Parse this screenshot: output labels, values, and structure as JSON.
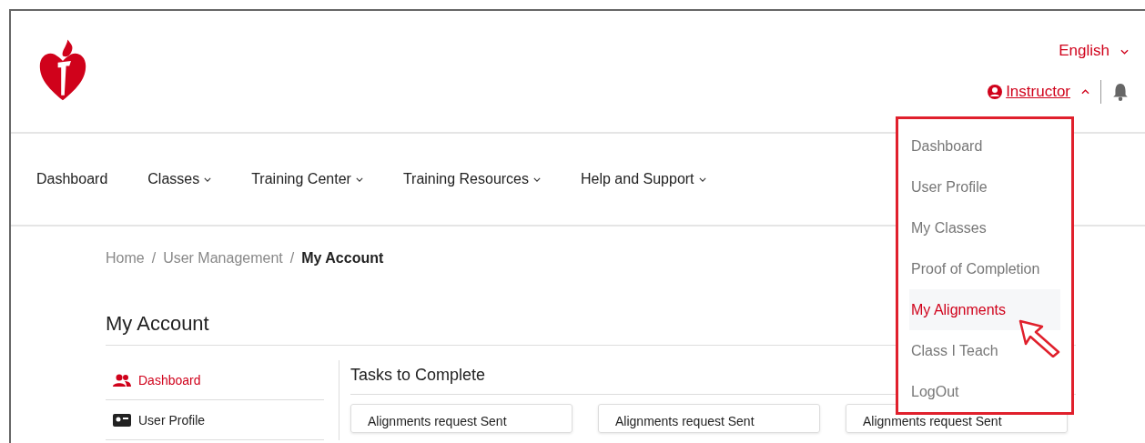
{
  "header": {
    "language": "English",
    "user": "Instructor"
  },
  "nav": [
    {
      "label": "Dashboard",
      "dropdown": false
    },
    {
      "label": "Classes",
      "dropdown": true
    },
    {
      "label": "Training Center",
      "dropdown": true
    },
    {
      "label": "Training Resources",
      "dropdown": true
    },
    {
      "label": "Help and Support",
      "dropdown": true
    }
  ],
  "user_menu": [
    {
      "label": "Dashboard",
      "selected": false
    },
    {
      "label": "User Profile",
      "selected": false
    },
    {
      "label": "My Classes",
      "selected": false
    },
    {
      "label": "Proof of Completion",
      "selected": false
    },
    {
      "label": "My Alignments",
      "selected": true
    },
    {
      "label": "Class I Teach",
      "selected": false
    },
    {
      "label": "LogOut",
      "selected": false
    }
  ],
  "breadcrumb_separator": "/",
  "breadcrumb": [
    {
      "label": "Home",
      "current": false
    },
    {
      "label": "User Management",
      "current": false
    },
    {
      "label": "My Account",
      "current": true
    }
  ],
  "page_title": "My Account",
  "sidebar": [
    {
      "label": "Dashboard",
      "kind": "users",
      "selected": true
    },
    {
      "label": "User Profile",
      "kind": "profile",
      "selected": false
    }
  ],
  "tasks": {
    "title": "Tasks to Complete",
    "cards": [
      {
        "title": "Alignments request Sent"
      },
      {
        "title": "Alignments request Sent"
      },
      {
        "title": "Alignments request Sent"
      }
    ]
  }
}
